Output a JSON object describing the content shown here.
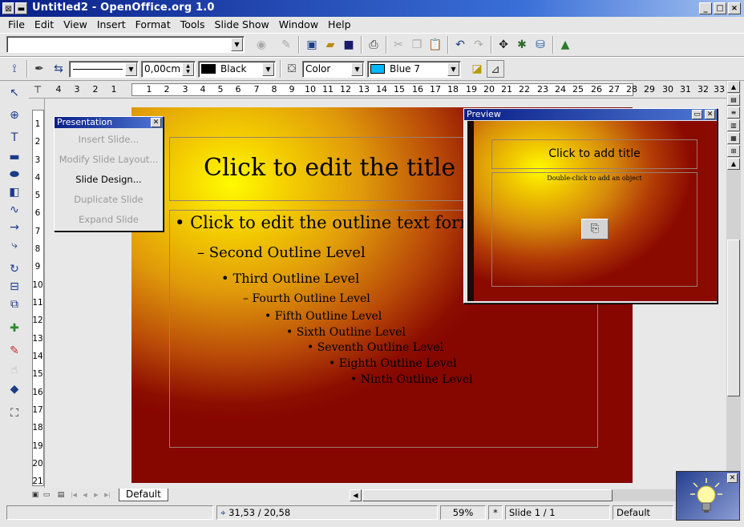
{
  "window": {
    "title": "Untitled2 - OpenOffice.org 1.0",
    "controls": [
      "_",
      "□",
      "×"
    ]
  },
  "menu": [
    "File",
    "Edit",
    "View",
    "Insert",
    "Format",
    "Tools",
    "Slide Show",
    "Window",
    "Help"
  ],
  "function_bar": {
    "url_value": ""
  },
  "object_bar": {
    "line_style": "",
    "line_width": "0,00cm",
    "line_color": {
      "label": "Black",
      "hex": "#000000"
    },
    "area_style": "Color",
    "area_color": {
      "label": "Blue 7",
      "hex": "#00b8ff"
    }
  },
  "hruler": {
    "left_numbers": [
      "4",
      "3",
      "2",
      "1"
    ],
    "right_numbers": [
      "1",
      "2",
      "3",
      "4",
      "5",
      "6",
      "7",
      "8",
      "9",
      "10",
      "11",
      "12",
      "13",
      "14",
      "15",
      "16",
      "17",
      "18",
      "19",
      "20",
      "21",
      "22",
      "23",
      "24",
      "25",
      "26",
      "27",
      "28",
      "29",
      "30",
      "31",
      "32",
      "33"
    ]
  },
  "vruler": {
    "numbers": [
      "1",
      "2",
      "3",
      "4",
      "5",
      "6",
      "7",
      "8",
      "9",
      "10",
      "11",
      "12",
      "13",
      "14",
      "15",
      "16",
      "17",
      "18",
      "19",
      "20",
      "21"
    ]
  },
  "slide": {
    "title": "Click to edit the title tex",
    "outline": [
      {
        "bullet": "•",
        "text": "Click to edit the outline text forma"
      },
      {
        "bullet": "–",
        "text": "Second Outline Level"
      },
      {
        "bullet": "•",
        "text": "Third Outline Level"
      },
      {
        "bullet": "–",
        "text": "Fourth Outline Level"
      },
      {
        "bullet": "•",
        "text": "Fifth Outline Level"
      },
      {
        "bullet": "•",
        "text": "Sixth Outline Level"
      },
      {
        "bullet": "•",
        "text": "Seventh Outline Level"
      },
      {
        "bullet": "•",
        "text": "Eighth Outline Level"
      },
      {
        "bullet": "•",
        "text": "Ninth Outline Level"
      }
    ]
  },
  "presentation_window": {
    "title": "Presentation",
    "items": [
      {
        "label": "Insert Slide...",
        "enabled": false
      },
      {
        "label": "Modify Slide Layout...",
        "enabled": false
      },
      {
        "label": "Slide Design...",
        "enabled": true
      },
      {
        "label": "Duplicate Slide",
        "enabled": false
      },
      {
        "label": "Expand Slide",
        "enabled": false
      }
    ]
  },
  "preview_window": {
    "title": "Preview",
    "title_placeholder": "Click to add title",
    "object_placeholder": "Double-click to add an object"
  },
  "tabs": {
    "active": "Default"
  },
  "status": {
    "position": "31,53 / 20,58",
    "zoom": "59%",
    "modified": "*",
    "slide": "Slide 1 / 1",
    "layout": "Default"
  }
}
